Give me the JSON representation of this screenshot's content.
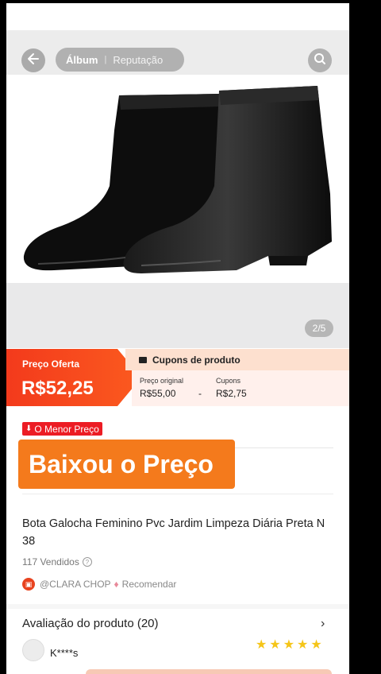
{
  "header": {
    "tabs": [
      "Álbum",
      "Reputação"
    ],
    "back_icon": "back-arrow-icon",
    "search_icon": "search-icon"
  },
  "gallery": {
    "counter": "2/5"
  },
  "price": {
    "offer_label": "Preço Oferta",
    "offer_value": "R$52,25",
    "coupon_header": "Cupons de produto",
    "original_label": "Preço original",
    "original_value": "R$55,00",
    "minus": "-",
    "coupon_label": "Cupons",
    "coupon_value": "R$2,75"
  },
  "badge": "O Menor Preço",
  "promo": "Baixou o Preço",
  "product": {
    "title": "Bota Galocha Feminino Pvc Jardim Limpeza Diária Preta N 38",
    "sold": "117 Vendidos",
    "seller": "@CLARA CHOP",
    "recommend": "Recomendar"
  },
  "reviews": {
    "title": "Avaliação do produto (20)",
    "reviewer": "K****s",
    "rating": 5
  },
  "colors": {
    "accent": "#f33a1c",
    "promo": "#f47a1c",
    "coupon_bg": "#fde0cf",
    "star": "#f5c518"
  }
}
